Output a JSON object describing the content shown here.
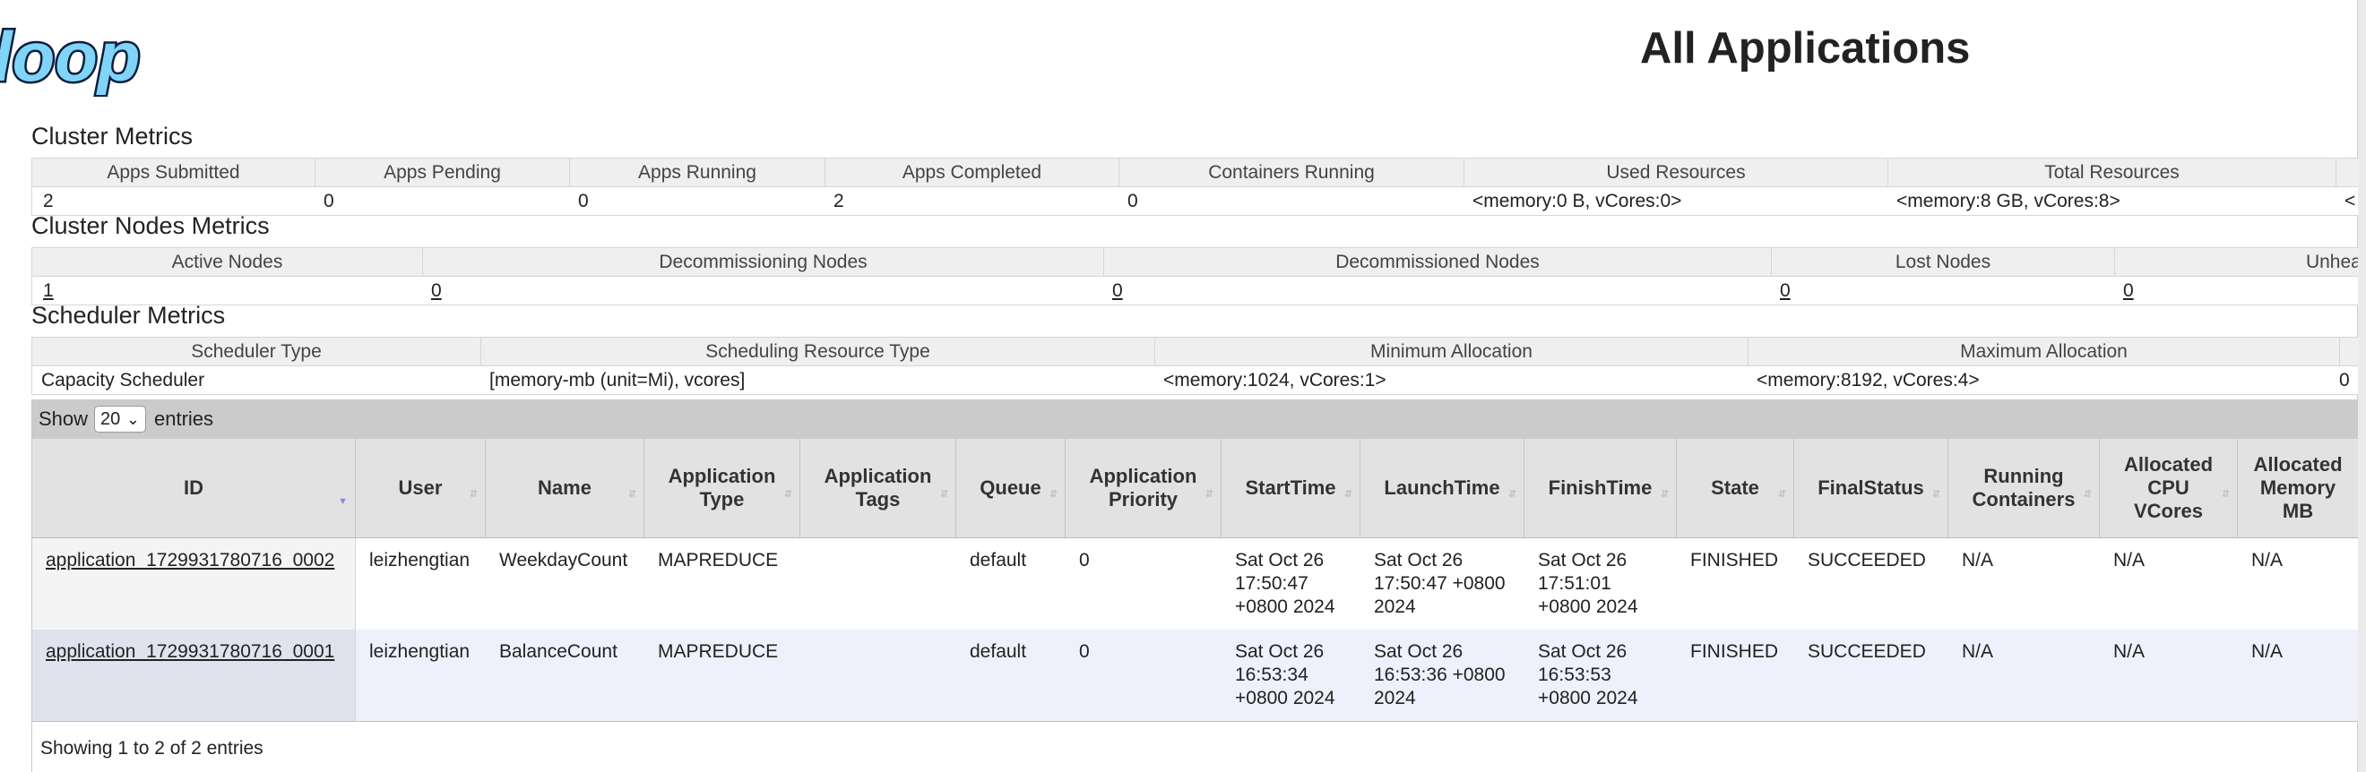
{
  "page": {
    "title": "All Applications",
    "logo_text": "doop"
  },
  "cluster_metrics": {
    "title": "Cluster Metrics",
    "headers": [
      "Apps Submitted",
      "Apps Pending",
      "Apps Running",
      "Apps Completed",
      "Containers Running",
      "Used Resources",
      "Total Resources",
      ""
    ],
    "values": [
      "2",
      "0",
      "0",
      "2",
      "0",
      "<memory:0 B, vCores:0>",
      "<memory:8 GB, vCores:8>",
      "<"
    ]
  },
  "cluster_nodes_metrics": {
    "title": "Cluster Nodes Metrics",
    "headers": [
      "Active Nodes",
      "Decommissioning Nodes",
      "Decommissioned Nodes",
      "Lost Nodes",
      "Unhealth"
    ],
    "values": [
      "1",
      "0",
      "0",
      "0",
      "0"
    ]
  },
  "scheduler_metrics": {
    "title": "Scheduler Metrics",
    "headers": [
      "Scheduler Type",
      "Scheduling Resource Type",
      "Minimum Allocation",
      "Maximum Allocation",
      ""
    ],
    "values": [
      "Capacity Scheduler",
      "[memory-mb (unit=Mi), vcores]",
      "<memory:1024, vCores:1>",
      "<memory:8192, vCores:4>",
      "0"
    ]
  },
  "apps_table": {
    "length": {
      "show": "Show",
      "selected": "20",
      "entries": "entries"
    },
    "headers": [
      "ID",
      "User",
      "Name",
      "Application Type",
      "Application Tags",
      "Queue",
      "Application Priority",
      "StartTime",
      "LaunchTime",
      "FinishTime",
      "State",
      "FinalStatus",
      "Running Containers",
      "Allocated CPU VCores",
      "Allocated Memory MB"
    ],
    "rows": [
      {
        "id": "application_1729931780716_0002",
        "user": "leizhengtian",
        "name": "WeekdayCount",
        "type": "MAPREDUCE",
        "tags": "",
        "queue": "default",
        "priority": "0",
        "start": "Sat Oct 26 17:50:47 +0800 2024",
        "launch": "Sat Oct 26 17:50:47 +0800 2024",
        "finish": "Sat Oct 26 17:51:01 +0800 2024",
        "state": "FINISHED",
        "final_status": "SUCCEEDED",
        "running_containers": "N/A",
        "cpu_vcores": "N/A",
        "memory_mb": "N/A"
      },
      {
        "id": "application_1729931780716_0001",
        "user": "leizhengtian",
        "name": "BalanceCount",
        "type": "MAPREDUCE",
        "tags": "",
        "queue": "default",
        "priority": "0",
        "start": "Sat Oct 26 16:53:34 +0800 2024",
        "launch": "Sat Oct 26 16:53:36 +0800 2024",
        "finish": "Sat Oct 26 16:53:53 +0800 2024",
        "state": "FINISHED",
        "final_status": "SUCCEEDED",
        "running_containers": "N/A",
        "cpu_vcores": "N/A",
        "memory_mb": "N/A"
      }
    ],
    "info": "Showing 1 to 2 of 2 entries"
  }
}
